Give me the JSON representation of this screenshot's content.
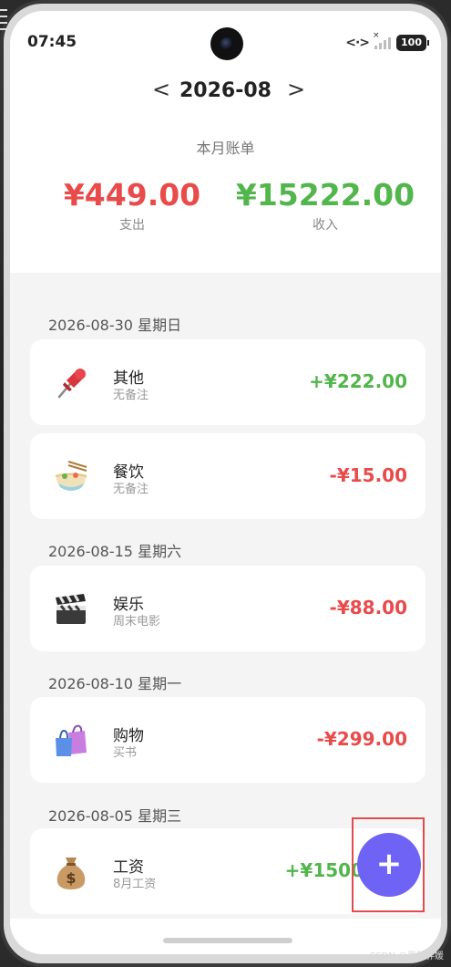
{
  "status_bar": {
    "time": "07:45",
    "battery": "100"
  },
  "header": {
    "prev_arrow": "<",
    "month": "2026-08",
    "next_arrow": ">",
    "title": "本月账单"
  },
  "summary": {
    "expense_amount": "¥449.00",
    "expense_label": "支出",
    "income_amount": "¥15222.00",
    "income_label": "收入"
  },
  "groups": [
    {
      "date": "2026-08-30 星期日",
      "items": [
        {
          "category": "其他",
          "note": "无备注",
          "amount": "+¥222.00",
          "type": "income",
          "icon": "pushpin-icon"
        },
        {
          "category": "餐饮",
          "note": "无备注",
          "amount": "-¥15.00",
          "type": "expense",
          "icon": "noodle-bowl-icon"
        }
      ]
    },
    {
      "date": "2026-08-15 星期六",
      "items": [
        {
          "category": "娱乐",
          "note": "周末电影",
          "amount": "-¥88.00",
          "type": "expense",
          "icon": "clapperboard-icon"
        }
      ]
    },
    {
      "date": "2026-08-10 星期一",
      "items": [
        {
          "category": "购物",
          "note": "买书",
          "amount": "-¥299.00",
          "type": "expense",
          "icon": "shopping-bags-icon"
        }
      ]
    },
    {
      "date": "2026-08-05 星期三",
      "items": [
        {
          "category": "工资",
          "note": "8月工资",
          "amount": "+¥1500",
          "type": "income",
          "icon": "money-bag-icon"
        }
      ]
    }
  ],
  "fab": {
    "label": "+",
    "icon": "add-icon"
  },
  "watermark": "CSDN @黑胖胖媛",
  "colors": {
    "expense": "#e94b4b",
    "income": "#52b64c",
    "accent": "#6f63f6"
  }
}
